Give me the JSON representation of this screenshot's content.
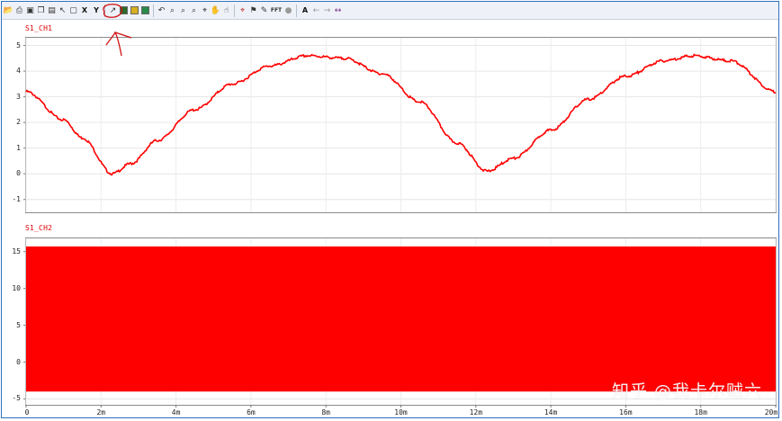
{
  "colors": {
    "trace": "#ff0000",
    "label": "#e00000",
    "annotation": "#d01010",
    "frame": "#2f6fbf"
  },
  "toolbar": {
    "icons": [
      "open-folder-icon",
      "print-icon",
      "save-icon",
      "copy-icon",
      "export-icon",
      "cursor-icon",
      "zoom-fit-icon",
      "x-cursor-label",
      "y-cursor-label",
      "measure-icon",
      "grid-toggle-icon",
      "add-plot-icon",
      "color-icon",
      "undo-icon",
      "zoom-in-icon",
      "zoom-out-icon",
      "zoom-area-icon",
      "zoom-reset-icon",
      "pan-icon",
      "hand-icon",
      "crosshair-icon",
      "flag-icon",
      "annotate-icon",
      "fft-icon",
      "settings-icon",
      "text-icon",
      "back-icon",
      "forward-icon",
      "resize-icon"
    ],
    "x_label": "X",
    "y_label": "Y",
    "fft_label": "FFT",
    "text_label": "A"
  },
  "panels": [
    {
      "label": "S1_CH1",
      "yticks": [
        "5",
        "4",
        "3",
        "2",
        "1",
        "0",
        "-1"
      ]
    },
    {
      "label": "S1_CH2",
      "yticks": [
        "15",
        "10",
        "5",
        "0",
        "-5"
      ]
    }
  ],
  "xaxis": {
    "ticks": [
      "0",
      "2m",
      "4m",
      "6m",
      "8m",
      "10m",
      "12m",
      "14m",
      "16m",
      "18m",
      "20m"
    ]
  },
  "chart_data": [
    {
      "type": "line",
      "title": "S1_CH1",
      "xlim": [
        0,
        0.02
      ],
      "ylim": [
        -1.5,
        5.3
      ],
      "x": [
        0,
        0.001,
        0.0015,
        0.0023,
        0.0028,
        0.0035,
        0.0045,
        0.0055,
        0.0065,
        0.0075,
        0.0085,
        0.0095,
        0.0105,
        0.0115,
        0.0123,
        0.013,
        0.014,
        0.015,
        0.016,
        0.017,
        0.0178,
        0.0188,
        0.02
      ],
      "y": [
        3.2,
        2.1,
        1.4,
        0.0,
        0.4,
        1.3,
        2.5,
        3.5,
        4.2,
        4.6,
        4.5,
        3.9,
        2.8,
        1.2,
        0.1,
        0.6,
        1.7,
        2.9,
        3.8,
        4.4,
        4.6,
        4.4,
        3.2
      ]
    },
    {
      "type": "area",
      "title": "S1_CH2",
      "xlim": [
        0,
        0.02
      ],
      "ylim": [
        -5.8,
        16.8
      ],
      "series": [
        {
          "values_max": [
            15.7,
            15.7
          ],
          "values_min": [
            -4.0,
            -4.0
          ],
          "x": [
            0,
            0.02
          ]
        }
      ]
    }
  ],
  "watermark": "知乎 @我卡尔贼六"
}
